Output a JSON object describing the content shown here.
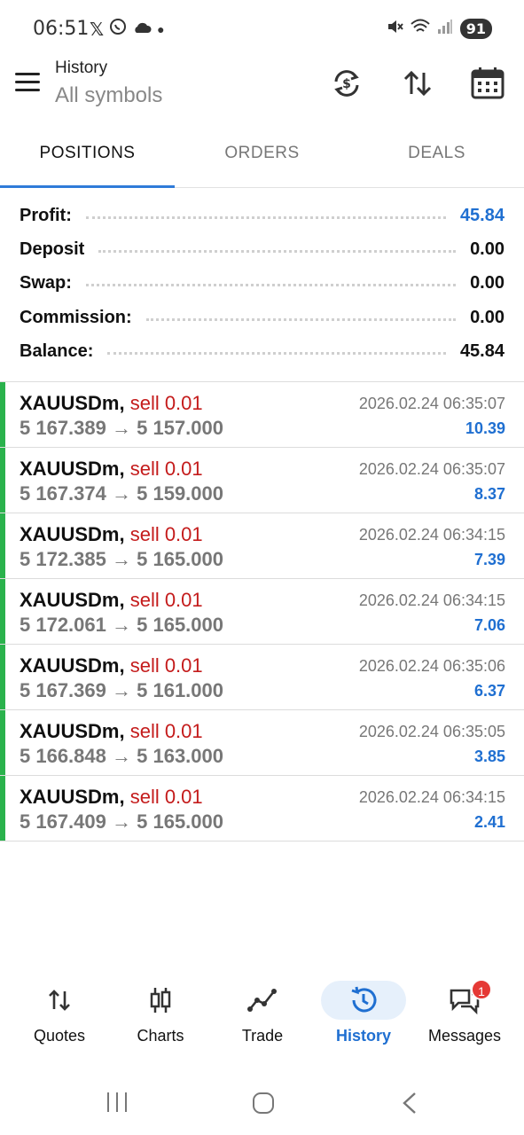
{
  "status_bar": {
    "time": "06:51",
    "battery": "91"
  },
  "app_bar": {
    "title": "History",
    "subtitle": "All symbols"
  },
  "tabs": [
    {
      "label": "POSITIONS",
      "active": true
    },
    {
      "label": "ORDERS",
      "active": false
    },
    {
      "label": "DEALS",
      "active": false
    }
  ],
  "summary": {
    "profit_label": "Profit:",
    "profit_value": "45.84",
    "deposit_label": "Deposit",
    "deposit_value": "0.00",
    "swap_label": "Swap:",
    "swap_value": "0.00",
    "commission_label": "Commission:",
    "commission_value": "0.00",
    "balance_label": "Balance:",
    "balance_value": "45.84"
  },
  "positions": [
    {
      "symbol": "XAUUSDm,",
      "side": "sell 0.01",
      "open": "5 167.389",
      "arrow": "→",
      "close": "5 157.000",
      "time": "2026.02.24 06:35:07",
      "profit": "10.39"
    },
    {
      "symbol": "XAUUSDm,",
      "side": "sell 0.01",
      "open": "5 167.374",
      "arrow": "→",
      "close": "5 159.000",
      "time": "2026.02.24 06:35:07",
      "profit": "8.37"
    },
    {
      "symbol": "XAUUSDm,",
      "side": "sell 0.01",
      "open": "5 172.385",
      "arrow": "→",
      "close": "5 165.000",
      "time": "2026.02.24 06:34:15",
      "profit": "7.39"
    },
    {
      "symbol": "XAUUSDm,",
      "side": "sell 0.01",
      "open": "5 172.061",
      "arrow": "→",
      "close": "5 165.000",
      "time": "2026.02.24 06:34:15",
      "profit": "7.06"
    },
    {
      "symbol": "XAUUSDm,",
      "side": "sell 0.01",
      "open": "5 167.369",
      "arrow": "→",
      "close": "5 161.000",
      "time": "2026.02.24 06:35:06",
      "profit": "6.37"
    },
    {
      "symbol": "XAUUSDm,",
      "side": "sell 0.01",
      "open": "5 166.848",
      "arrow": "→",
      "close": "5 163.000",
      "time": "2026.02.24 06:35:05",
      "profit": "3.85"
    },
    {
      "symbol": "XAUUSDm,",
      "side": "sell 0.01",
      "open": "5 167.409",
      "arrow": "→",
      "close": "5 165.000",
      "time": "2026.02.24 06:34:15",
      "profit": "2.41"
    }
  ],
  "bottom_nav": [
    {
      "label": "Quotes",
      "icon": "quotes-icon",
      "active": false
    },
    {
      "label": "Charts",
      "icon": "charts-icon",
      "active": false
    },
    {
      "label": "Trade",
      "icon": "trade-icon",
      "active": false
    },
    {
      "label": "History",
      "icon": "history-icon",
      "active": true
    },
    {
      "label": "Messages",
      "icon": "messages-icon",
      "active": false,
      "badge": "1"
    }
  ],
  "colors": {
    "accent": "#1f6fd1",
    "sell": "#c41b1b",
    "position_bar": "#2ab24c",
    "badge": "#e53935"
  }
}
